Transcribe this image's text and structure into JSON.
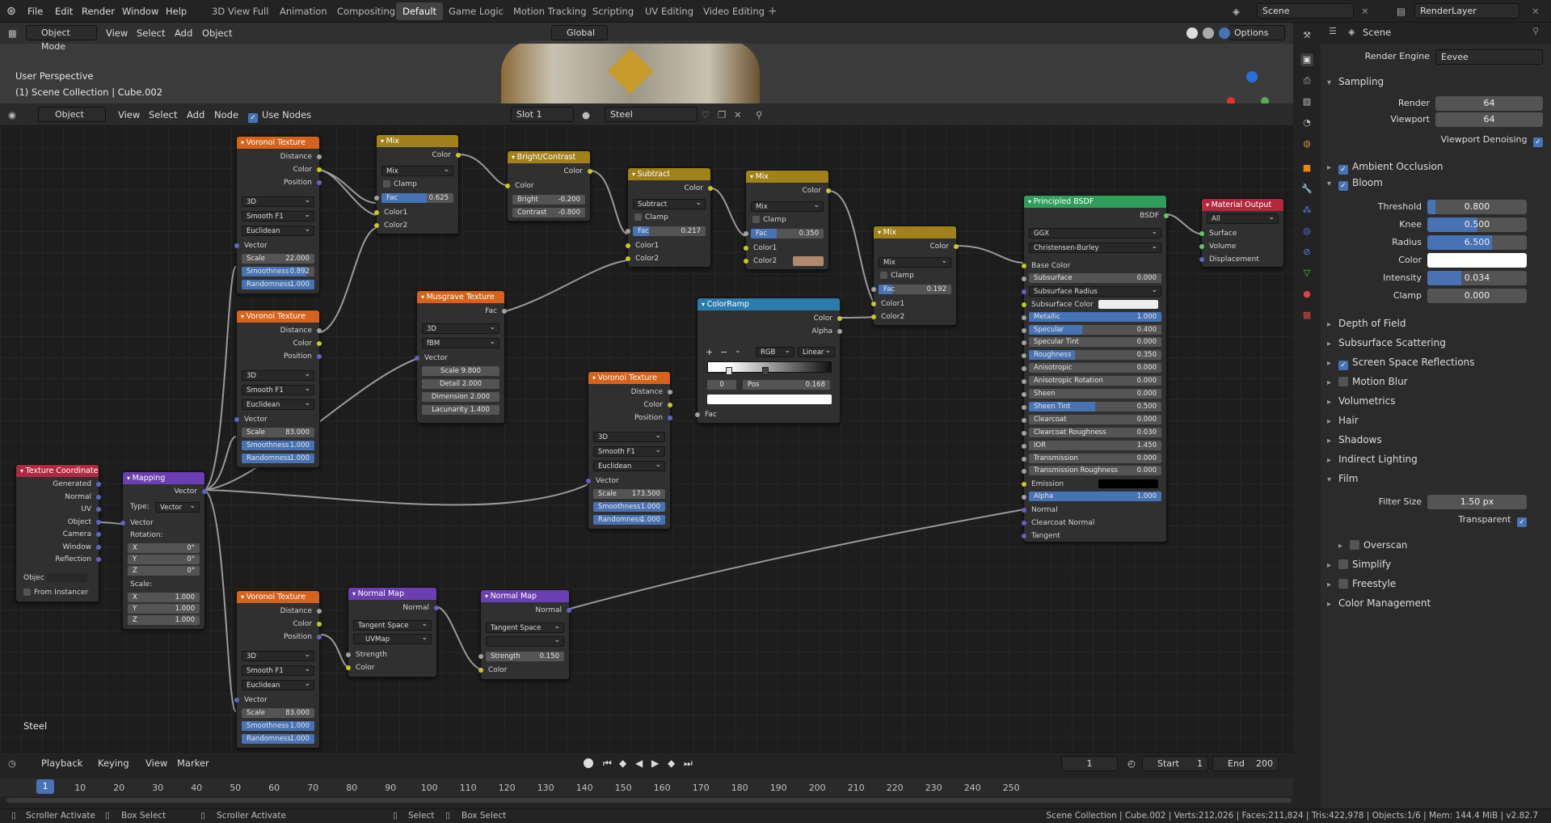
{
  "app": {
    "menus": [
      "File",
      "Edit",
      "Render",
      "Window",
      "Help"
    ],
    "workspaces": [
      "3D View Full",
      "Animation",
      "Compositing",
      "Default",
      "Game Logic",
      "Motion Tracking",
      "Scripting",
      "UV Editing",
      "Video Editing"
    ],
    "active_workspace": "Default",
    "scene": "Scene",
    "view_layer": "RenderLayer"
  },
  "viewport": {
    "mode": "Object Mode",
    "menus": [
      "View",
      "Select",
      "Add",
      "Object"
    ],
    "orientation": "Global",
    "options": "Options",
    "overlay_line1": "User Perspective",
    "overlay_line2": "(1) Scene Collection | Cube.002"
  },
  "node_editor": {
    "type": "Object",
    "menus": [
      "View",
      "Select",
      "Add",
      "Node"
    ],
    "use_nodes": "Use Nodes",
    "slot": "Slot 1",
    "material": "Steel",
    "footer_label": "Steel"
  },
  "nodes": {
    "voronoi1": {
      "title": "Voronoi Texture",
      "outputs": [
        "Distance",
        "Color",
        "Position"
      ],
      "dims": "3D",
      "feature": "Smooth F1",
      "metric": "Euclidean",
      "vector": "Vector",
      "scale_label": "Scale",
      "scale": "22.000",
      "smooth_label": "Smoothness",
      "smooth": "0.892",
      "rand_label": "Randomness",
      "rand": "1.000"
    },
    "voronoi2": {
      "title": "Voronoi Texture",
      "outputs": [
        "Distance",
        "Color",
        "Position"
      ],
      "dims": "3D",
      "feature": "Smooth F1",
      "metric": "Euclidean",
      "vector": "Vector",
      "scale_label": "Scale",
      "scale": "83.000",
      "smooth_label": "Smoothness",
      "smooth": "1.000",
      "rand_label": "Randomness",
      "rand": "1.000"
    },
    "voronoi3": {
      "title": "Voronoi Texture",
      "outputs": [
        "Distance",
        "Color",
        "Position"
      ],
      "dims": "3D",
      "feature": "Smooth F1",
      "metric": "Euclidean",
      "vector": "Vector",
      "scale_label": "Scale",
      "scale": "83.000",
      "smooth_label": "Smoothness",
      "smooth": "1.000",
      "rand_label": "Randomness",
      "rand": "1.000"
    },
    "voronoi4": {
      "title": "Voronoi Texture",
      "outputs": [
        "Distance",
        "Color",
        "Position"
      ],
      "dims": "3D",
      "feature": "Smooth F1",
      "metric": "Euclidean",
      "vector": "Vector",
      "scale_label": "Scale",
      "scale": "173.500",
      "smooth_label": "Smoothness",
      "smooth": "1.000",
      "rand_label": "Randomness",
      "rand": "1.000"
    },
    "mix1": {
      "title": "Mix",
      "out": "Color",
      "mode": "Mix",
      "clamp": "Clamp",
      "fac_label": "Fac",
      "fac": "0.625",
      "in1": "Color1",
      "in2": "Color2"
    },
    "bright": {
      "title": "Bright/Contrast",
      "out": "Color",
      "in": "Color",
      "bright_label": "Bright",
      "bright": "-0.200",
      "contrast_label": "Contrast",
      "contrast": "-0.800"
    },
    "subtract": {
      "title": "Subtract",
      "out": "Color",
      "mode": "Subtract",
      "clamp": "Clamp",
      "fac_label": "Fac",
      "fac": "0.217",
      "in1": "Color1",
      "in2": "Color2"
    },
    "mix2": {
      "title": "Mix",
      "out": "Color",
      "mode": "Mix",
      "clamp": "Clamp",
      "fac_label": "Fac",
      "fac": "0.350",
      "in1": "Color1",
      "in2": "Color2"
    },
    "mix3": {
      "title": "Mix",
      "out": "Color",
      "mode": "Mix",
      "clamp": "Clamp",
      "fac_label": "Fac",
      "fac": "0.192",
      "in1": "Color1",
      "in2": "Color2"
    },
    "musgrave": {
      "title": "Musgrave Texture",
      "out": "Fac",
      "dims": "3D",
      "type": "fBM",
      "vector": "Vector",
      "scale_label": "Scale",
      "scale": "9.800",
      "detail_label": "Detail",
      "detail": "2.000",
      "dim_label": "Dimension",
      "dim": "2.000",
      "lac_label": "Lacunarity",
      "lac": "1.400"
    },
    "colorramp": {
      "title": "ColorRamp",
      "out1": "Color",
      "out2": "Alpha",
      "plus": "+",
      "minus": "−",
      "mode": "RGB",
      "interp": "Linear",
      "index": "0",
      "pos_label": "Pos",
      "pos": "0.168",
      "in": "Fac"
    },
    "principled": {
      "title": "Principled BSDF",
      "out": "BSDF",
      "dist": "GGX",
      "sss": "Christensen-Burley",
      "rows": [
        [
          "Base Color",
          ""
        ],
        [
          "Subsurface",
          "0.000"
        ],
        [
          "Subsurface Radius",
          ""
        ],
        [
          "Subsurface Color",
          ""
        ],
        [
          "Metallic",
          "1.000"
        ],
        [
          "Specular",
          "0.400"
        ],
        [
          "Specular Tint",
          "0.000"
        ],
        [
          "Roughness",
          "0.350"
        ],
        [
          "Anisotropic",
          "0.000"
        ],
        [
          "Anisotropic Rotation",
          "0.000"
        ],
        [
          "Sheen",
          "0.000"
        ],
        [
          "Sheen Tint",
          "0.500"
        ],
        [
          "Clearcoat",
          "0.000"
        ],
        [
          "Clearcoat Roughness",
          "0.030"
        ],
        [
          "IOR",
          "1.450"
        ],
        [
          "Transmission",
          "0.000"
        ],
        [
          "Transmission Roughness",
          "0.000"
        ],
        [
          "Emission",
          ""
        ],
        [
          "Alpha",
          "1.000"
        ],
        [
          "Normal",
          ""
        ],
        [
          "Clearcoat Normal",
          ""
        ],
        [
          "Tangent",
          ""
        ]
      ]
    },
    "matout": {
      "title": "Material Output",
      "target": "All",
      "ins": [
        "Surface",
        "Volume",
        "Displacement"
      ]
    },
    "texcoord": {
      "title": "Texture Coordinate",
      "outputs": [
        "Generated",
        "Normal",
        "UV",
        "Object",
        "Camera",
        "Window",
        "Reflection"
      ],
      "object_label": "Objec",
      "instancer": "From Instancer"
    },
    "mapping": {
      "title": "Mapping",
      "out": "Vector",
      "type_label": "Type:",
      "type": "Vector",
      "vector": "Vector",
      "rot_label": "Rotation:",
      "rx": "0°",
      "ry": "0°",
      "rz": "0°",
      "scale_label": "Scale:",
      "sx": "1.000",
      "sy": "1.000",
      "sz": "1.000",
      "x": "X",
      "y": "Y",
      "z": "Z"
    },
    "nmap1": {
      "title": "Normal Map",
      "out": "Normal",
      "space": "Tangent Space",
      "uv": "UVMap",
      "strength_label": "Strength",
      "color": "Color"
    },
    "nmap2": {
      "title": "Normal Map",
      "out": "Normal",
      "space": "Tangent Space",
      "strength_label": "Strength",
      "strength": "0.150",
      "color": "Color"
    }
  },
  "timeline": {
    "menus": [
      "Playback",
      "Keying",
      "View",
      "Marker"
    ],
    "current": "1",
    "start_label": "Start",
    "start": "1",
    "end_label": "End",
    "end": "200",
    "ticks": [
      "1",
      "10",
      "20",
      "30",
      "40",
      "50",
      "60",
      "70",
      "80",
      "90",
      "100",
      "110",
      "120",
      "130",
      "140",
      "150",
      "160",
      "170",
      "180",
      "190",
      "200",
      "210",
      "220",
      "230",
      "240",
      "250"
    ]
  },
  "status": {
    "items": [
      "Scroller Activate",
      "Box Select",
      "Scroller Activate",
      "Select",
      "Box Select"
    ],
    "right": "Scene Collection | Cube.002 | Verts:212,026 | Faces:211,824 | Tris:422,978 | Objects:1/6 | Mem: 144.4 MiB | v2.82.7"
  },
  "properties": {
    "context": "Scene",
    "render_engine_label": "Render Engine",
    "render_engine": "Eevee",
    "sampling": "Sampling",
    "render_label": "Render",
    "render": "64",
    "viewport_label": "Viewport",
    "viewport": "64",
    "denoise": "Viewport Denoising",
    "ao": "Ambient Occlusion",
    "bloom": "Bloom",
    "threshold_label": "Threshold",
    "threshold": "0.800",
    "knee_label": "Knee",
    "knee": "0.500",
    "radius_label": "Radius",
    "radius": "6.500",
    "color_label": "Color",
    "intensity_label": "Intensity",
    "intensity": "0.034",
    "clamp_label": "Clamp",
    "clamp": "0.000",
    "dof": "Depth of Field",
    "sss": "Subsurface Scattering",
    "ssr": "Screen Space Reflections",
    "motion_blur": "Motion Blur",
    "volumetrics": "Volumetrics",
    "hair": "Hair",
    "shadows": "Shadows",
    "indirect": "Indirect Lighting",
    "film": "Film",
    "filter_label": "Filter Size",
    "filter": "1.50 px",
    "transparent": "Transparent",
    "overscan": "Overscan",
    "simplify": "Simplify",
    "freestyle": "Freestyle",
    "color_mgmt": "Color Management",
    "bloom_color": "#ffffff"
  }
}
